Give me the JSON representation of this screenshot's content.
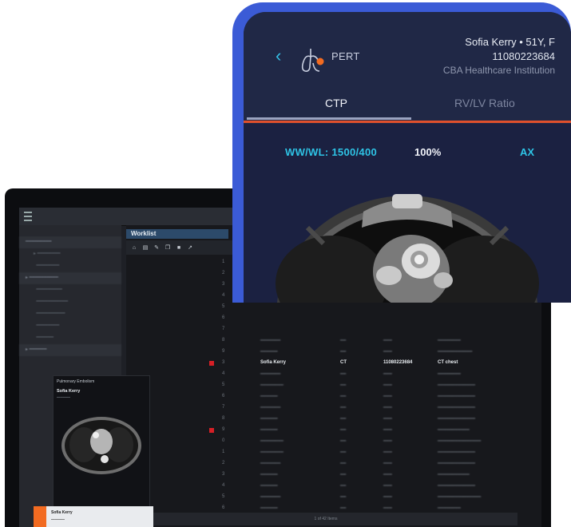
{
  "mobile": {
    "app_name": "PERT",
    "patient_name": "Sofia Kerry • 51Y, F",
    "patient_id": "11080223684",
    "institution": "CBA Healthcare Institution",
    "tabs": [
      {
        "label": "CTP",
        "active": true
      },
      {
        "label": "RV/LV Ratio",
        "active": false
      }
    ],
    "window_level": "WW/WL: 1500/400",
    "zoom": "100%",
    "plane": "AX",
    "colors": {
      "accent": "#2ec4e6",
      "tab_underline": "#e0502c",
      "frame": "#3b5bd6"
    }
  },
  "desktop": {
    "worklist_title": "Worklist",
    "toolbar_icons": [
      "home-icon",
      "file-icon",
      "edit-icon",
      "copy-icon",
      "lock-icon",
      "share-icon"
    ],
    "selected_row": {
      "name": "Sofia Kerry",
      "modality": "CT",
      "id": "11080223684",
      "description": "CT chest"
    },
    "pagination": "1 of 42 Items",
    "viewer": {
      "title": "Pulmonary Embolism",
      "name": "Sofia Kerry"
    }
  }
}
